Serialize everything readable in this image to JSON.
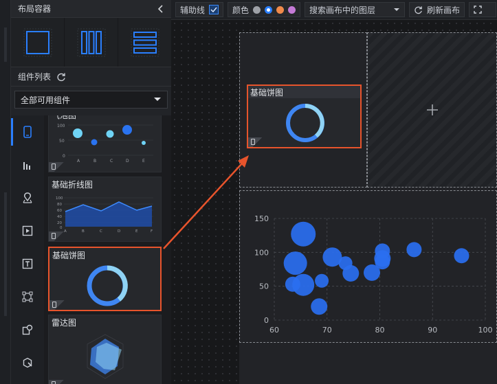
{
  "panel": {
    "title": "布局容器",
    "component_list_title": "组件列表",
    "filter_select": "全部可用组件"
  },
  "components": [
    {
      "name": "气泡图",
      "axis_y": [
        "100",
        "50",
        "0"
      ],
      "axis_x": [
        "A",
        "B",
        "C",
        "D",
        "E"
      ]
    },
    {
      "name": "基础折线图",
      "axis_y": [
        "100",
        "80",
        "60",
        "40",
        "20",
        "0"
      ],
      "axis_x": [
        "A",
        "B",
        "C",
        "D",
        "E",
        "F"
      ]
    },
    {
      "name": "基础饼图"
    },
    {
      "name": "雷达图"
    }
  ],
  "toolbar": {
    "guides_label": "辅助线",
    "guides_checked": true,
    "color_label": "颜色",
    "colors": [
      "#9ea1a7",
      "#2a7fff",
      "#f08a4b",
      "#c47ad6"
    ],
    "search_placeholder": "搜索画布中的图层",
    "refresh_label": "刷新画布"
  },
  "canvas": {
    "pie_widget_title": "基础饼图",
    "empty_cell_icon": "plus-icon"
  },
  "chart_data": {
    "type": "scatter",
    "x_ticks": [
      "60",
      "70",
      "80",
      "90",
      "100"
    ],
    "y_ticks": [
      "0",
      "50",
      "100",
      "150"
    ],
    "xlim": [
      60,
      100
    ],
    "ylim": [
      0,
      150
    ],
    "grid": true,
    "points": [
      {
        "x": 65.5,
        "y": 127,
        "r": 18
      },
      {
        "x": 64,
        "y": 84,
        "r": 17
      },
      {
        "x": 65.5,
        "y": 52,
        "r": 16
      },
      {
        "x": 63.5,
        "y": 53,
        "r": 11
      },
      {
        "x": 69,
        "y": 58,
        "r": 10
      },
      {
        "x": 68.5,
        "y": 20,
        "r": 12
      },
      {
        "x": 71,
        "y": 93,
        "r": 14
      },
      {
        "x": 73.5,
        "y": 84,
        "r": 10
      },
      {
        "x": 74.5,
        "y": 69,
        "r": 12
      },
      {
        "x": 78.5,
        "y": 70,
        "r": 12
      },
      {
        "x": 80.5,
        "y": 102,
        "r": 11
      },
      {
        "x": 80.5,
        "y": 91,
        "r": 12
      },
      {
        "x": 80.5,
        "y": 86,
        "r": 11
      },
      {
        "x": 86.5,
        "y": 104,
        "r": 11
      },
      {
        "x": 95.5,
        "y": 95,
        "r": 11
      }
    ]
  }
}
